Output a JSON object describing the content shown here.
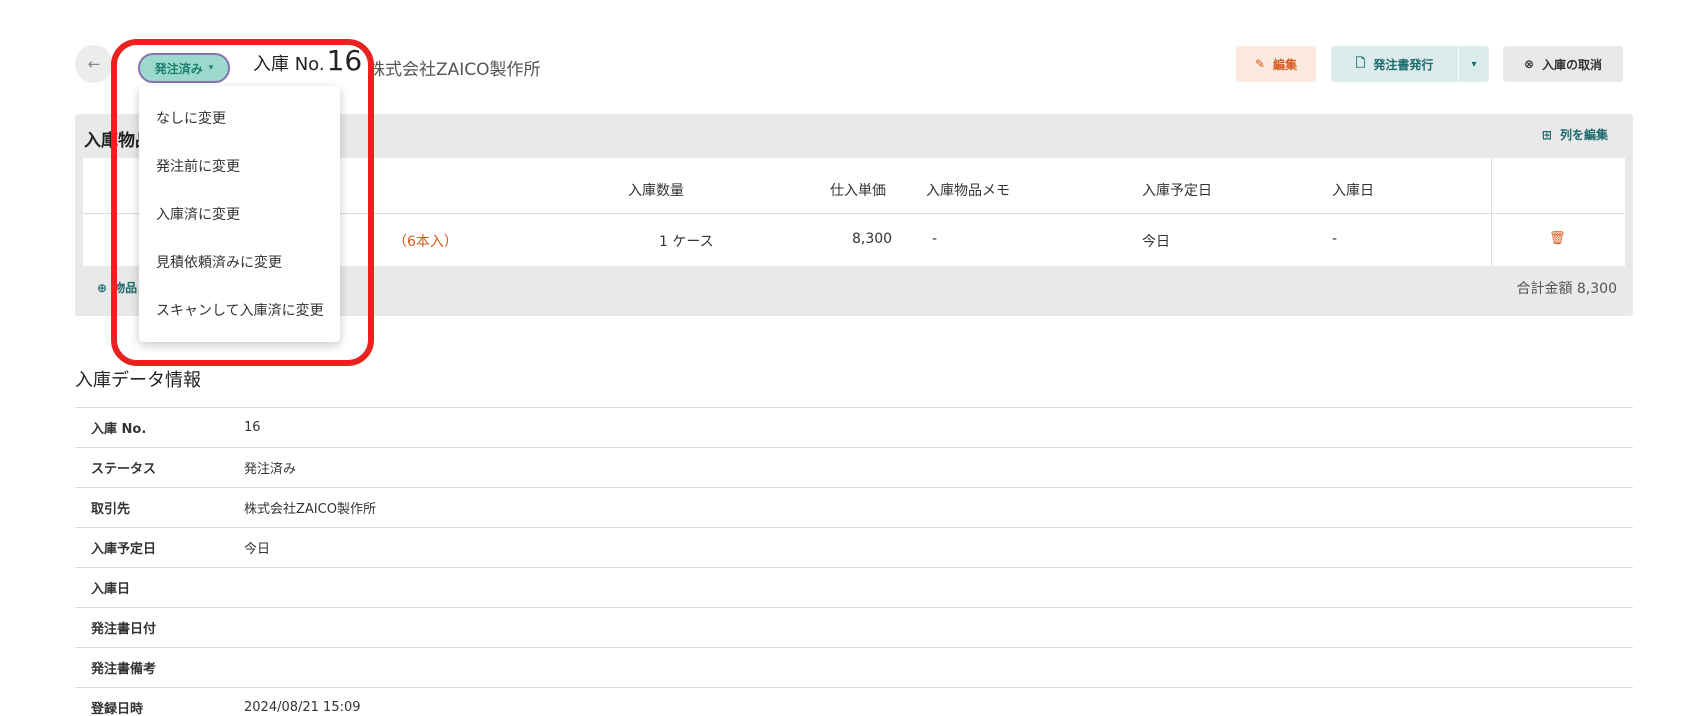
{
  "header": {
    "status_label": "発注済み",
    "title_label": "入庫 No.",
    "title_number": "16",
    "supplier": "株式会社ZAICO製作所",
    "edit_label": "編集",
    "issue_label": "発注書発行",
    "cancel_label": "入庫の取消"
  },
  "dropdown": {
    "items": [
      "なしに変更",
      "発注前に変更",
      "入庫済に変更",
      "見積依頼済みに変更",
      "スキャンして入庫済に変更"
    ]
  },
  "items_panel": {
    "title": "入庫物品",
    "edit_columns_label": "列を編集",
    "columns": [
      "入庫数量",
      "仕入単価",
      "入庫物品メモ",
      "入庫予定日",
      "入庫日"
    ],
    "row": {
      "name_suffix": "（6本入）",
      "quantity": "1 ケース",
      "unit_price": "8,300",
      "memo": "-",
      "scheduled_date": "今日",
      "received_date": "-"
    },
    "add_item_label": "物品",
    "total_label": "合計金額",
    "total_value": "8,300"
  },
  "info": {
    "title": "入庫データ情報",
    "rows": [
      {
        "key": "入庫 No.",
        "value": "16"
      },
      {
        "key": "ステータス",
        "value": "発注済み"
      },
      {
        "key": "取引先",
        "value": "株式会社ZAICO製作所"
      },
      {
        "key": "入庫予定日",
        "value": "今日"
      },
      {
        "key": "入庫日",
        "value": ""
      },
      {
        "key": "発注書日付",
        "value": ""
      },
      {
        "key": "発注書備考",
        "value": ""
      },
      {
        "key": "登録日時",
        "value": "2024/08/21 15:09"
      }
    ]
  },
  "colors": {
    "accent_teal": "#1c6a6c",
    "accent_orange": "#d8591e",
    "highlight_red": "#e8231f"
  }
}
